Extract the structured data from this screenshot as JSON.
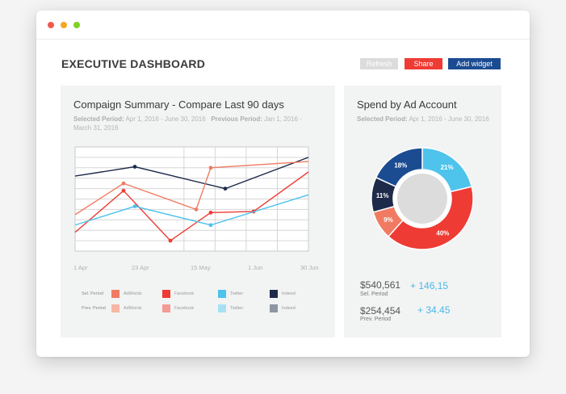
{
  "colors": {
    "dot_red": "#ee5a4f",
    "dot_yellow": "#f5a623",
    "dot_green": "#7ed321",
    "accent_red": "#ee3b34",
    "accent_navy": "#1b4c92",
    "adwords": "#f07b62",
    "facebook": "#ee3b34",
    "twitter": "#4ec3ec",
    "indeed": "#1e2a4a",
    "adwords_prev": "#f6b8a5",
    "facebook_prev": "#f39b94",
    "twitter_prev": "#a8e0f3",
    "indeed_prev": "#8f96a3"
  },
  "header": {
    "title": "EXECUTIVE DASHBOARD",
    "refresh_label": "Refresh",
    "share_label": "Share",
    "add_widget_label": "Add widget"
  },
  "campaign": {
    "title": "Compaign Summary - Compare Last 90 days",
    "selected_label": "Selected Period:",
    "selected_value": "Apr 1, 2016 - June 30, 2016",
    "previous_label": "Previous Period:",
    "previous_value_1": "Jan 1, 2016 -",
    "previous_value_2": "March 31, 2016",
    "legend": {
      "sel_label": "Sel. Period",
      "prev_label": "Prev. Period",
      "items": [
        "AdWords",
        "Facebook",
        "Twitter",
        "Indeed"
      ]
    }
  },
  "spend": {
    "title": "Spend by Ad Account",
    "selected_label": "Selected Period:",
    "selected_value": "Apr 1, 2016 - June 30, 2016",
    "sel_value": "$540,561",
    "sel_label": "Sel. Period",
    "sel_delta": "+ 146,15",
    "prev_value": "$254,454",
    "prev_label": "Prev. Period",
    "prev_delta": "+ 34.45"
  },
  "chart_data": [
    {
      "type": "line",
      "x": [
        "1 Apr",
        "13 Apr",
        "23 Apr",
        "5 May",
        "15 May",
        "17 May",
        "26 May",
        "1 Jun",
        "30 Jun"
      ],
      "xticks": [
        "1 Apr",
        "23 Apr",
        "15 May",
        "1 Jun",
        "30 Jun"
      ],
      "series": [
        {
          "name": "Indeed",
          "values": [
            7.2,
            null,
            8.1,
            null,
            null,
            null,
            6.0,
            null,
            9.0
          ],
          "color": "#1e2a4a"
        },
        {
          "name": "AdWords",
          "values": [
            3.5,
            6.5,
            null,
            null,
            4.0,
            8.0,
            null,
            null,
            8.6
          ],
          "color": "#f07b62"
        },
        {
          "name": "Facebook",
          "values": [
            1.8,
            5.8,
            null,
            1.0,
            null,
            3.7,
            null,
            3.8,
            7.6
          ],
          "color": "#ee3b34"
        },
        {
          "name": "Twitter",
          "values": [
            2.5,
            null,
            4.3,
            null,
            null,
            2.5,
            null,
            null,
            5.4
          ],
          "color": "#4ec3ec"
        }
      ],
      "grid": true
    },
    {
      "type": "pie",
      "categories": [
        "Twitter",
        "Facebook",
        "AdWords",
        "Indeed",
        "Other"
      ],
      "values": [
        21,
        40,
        9,
        11,
        18
      ],
      "labels": [
        "21%",
        "40%",
        "9%",
        "11%",
        "18%"
      ],
      "colors": [
        "#4ec3ec",
        "#ee3b34",
        "#f07b62",
        "#1e2a4a",
        "#1b4c92"
      ]
    }
  ]
}
